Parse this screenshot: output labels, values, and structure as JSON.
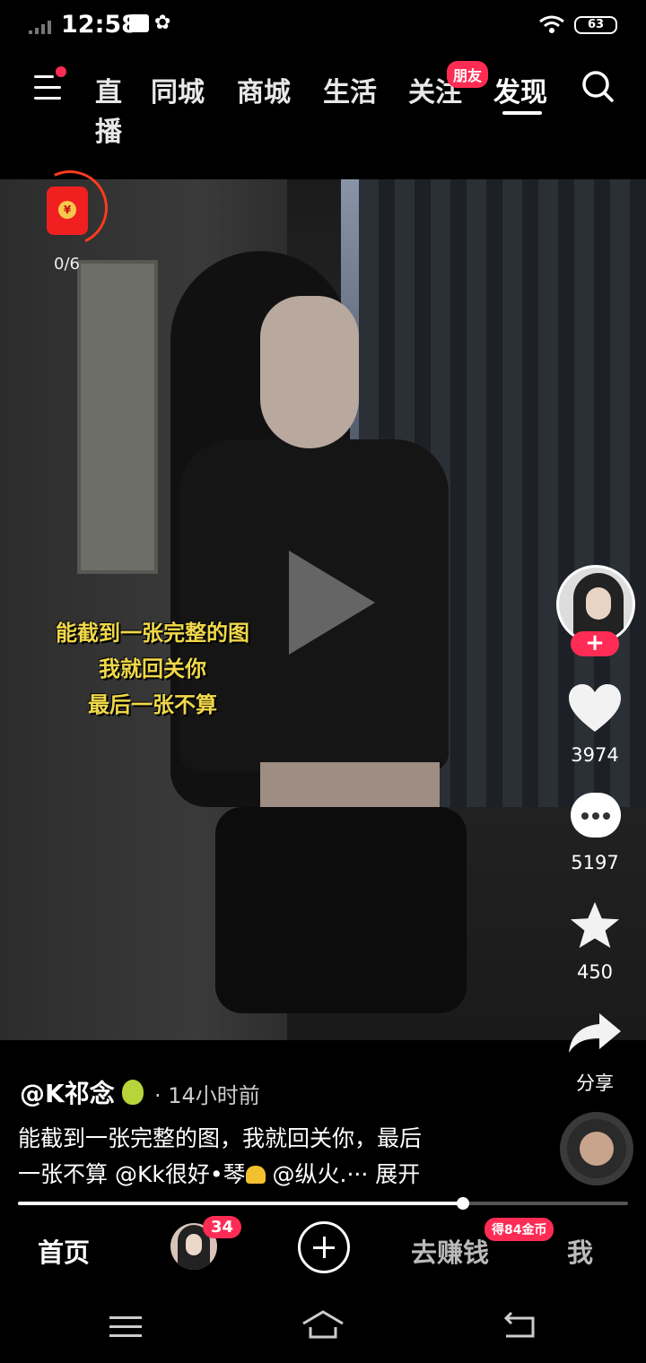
{
  "status_bar": {
    "time": "12:58",
    "battery": "63"
  },
  "top_nav": {
    "tabs": [
      "直播",
      "同城",
      "商城",
      "生活",
      "关注",
      "发现"
    ],
    "active_tab": "发现",
    "friend_badge": "朋友"
  },
  "red_packet": {
    "progress": "0/6"
  },
  "video": {
    "caption_lines": [
      "能截到一张完整的图",
      "我就回关你",
      "最后一张不算"
    ]
  },
  "side_actions": {
    "likes": "3974",
    "comments": "5197",
    "favorites": "450",
    "share_label": "分享"
  },
  "post": {
    "author": "@K祁念",
    "time": "· 14小时前",
    "description_line1": "能截到一张完整的图，我就回关你，最后",
    "description_line2a": "一张不算 @Kk很好•琴",
    "description_line2b": " @纵火.··· ",
    "expand_label": "展开",
    "playback_progress": 0.73
  },
  "bottom_nav": {
    "home": "首页",
    "friends_badge": "34",
    "earn": "去赚钱",
    "earn_badge": "得84金币",
    "me": "我"
  },
  "colors": {
    "accent": "#fe2c55",
    "caption_yellow": "#f0d84a"
  }
}
